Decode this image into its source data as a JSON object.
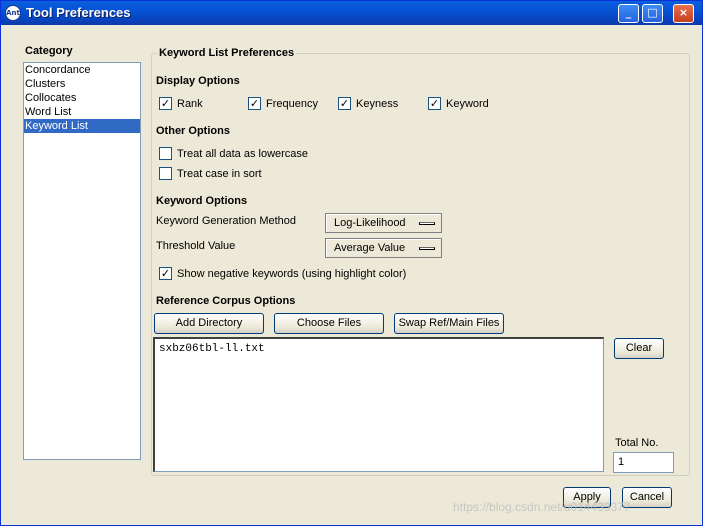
{
  "window": {
    "title": "Tool Preferences",
    "icon_text": "Ant",
    "controls": {
      "minimize": "_",
      "maximize": "□",
      "close": "×"
    }
  },
  "category": {
    "label": "Category",
    "items": [
      "Concordance",
      "Clusters",
      "Collocates",
      "Word List",
      "Keyword List"
    ],
    "selected": "Keyword List"
  },
  "panel": {
    "title": "Keyword List Preferences",
    "display_options": {
      "heading": "Display Options",
      "checks": [
        {
          "label": "Rank",
          "checked": true
        },
        {
          "label": "Frequency",
          "checked": true
        },
        {
          "label": "Keyness",
          "checked": true
        },
        {
          "label": "Keyword",
          "checked": true
        }
      ]
    },
    "other_options": {
      "heading": "Other Options",
      "checks": [
        {
          "label": "Treat all data as lowercase",
          "checked": false
        },
        {
          "label": "Treat case in sort",
          "checked": false
        }
      ]
    },
    "keyword_options": {
      "heading": "Keyword Options",
      "generation_label": "Keyword Generation Method",
      "generation_value": "Log-Likelihood",
      "threshold_label": "Threshold Value",
      "threshold_value": "Average Value",
      "negative": {
        "label": "Show negative keywords (using highlight color)",
        "checked": true
      }
    },
    "reference": {
      "heading": "Reference Corpus Options",
      "add_directory": "Add Directory",
      "choose_files": "Choose Files",
      "swap": "Swap Ref/Main Files",
      "files": [
        "sxbz06tbl-ll.txt"
      ],
      "clear": "Clear",
      "total_label": "Total No.",
      "total_value": "1"
    }
  },
  "footer": {
    "apply": "Apply",
    "cancel": "Cancel"
  },
  "watermark": "https://blog.csdn.net/u014433377"
}
